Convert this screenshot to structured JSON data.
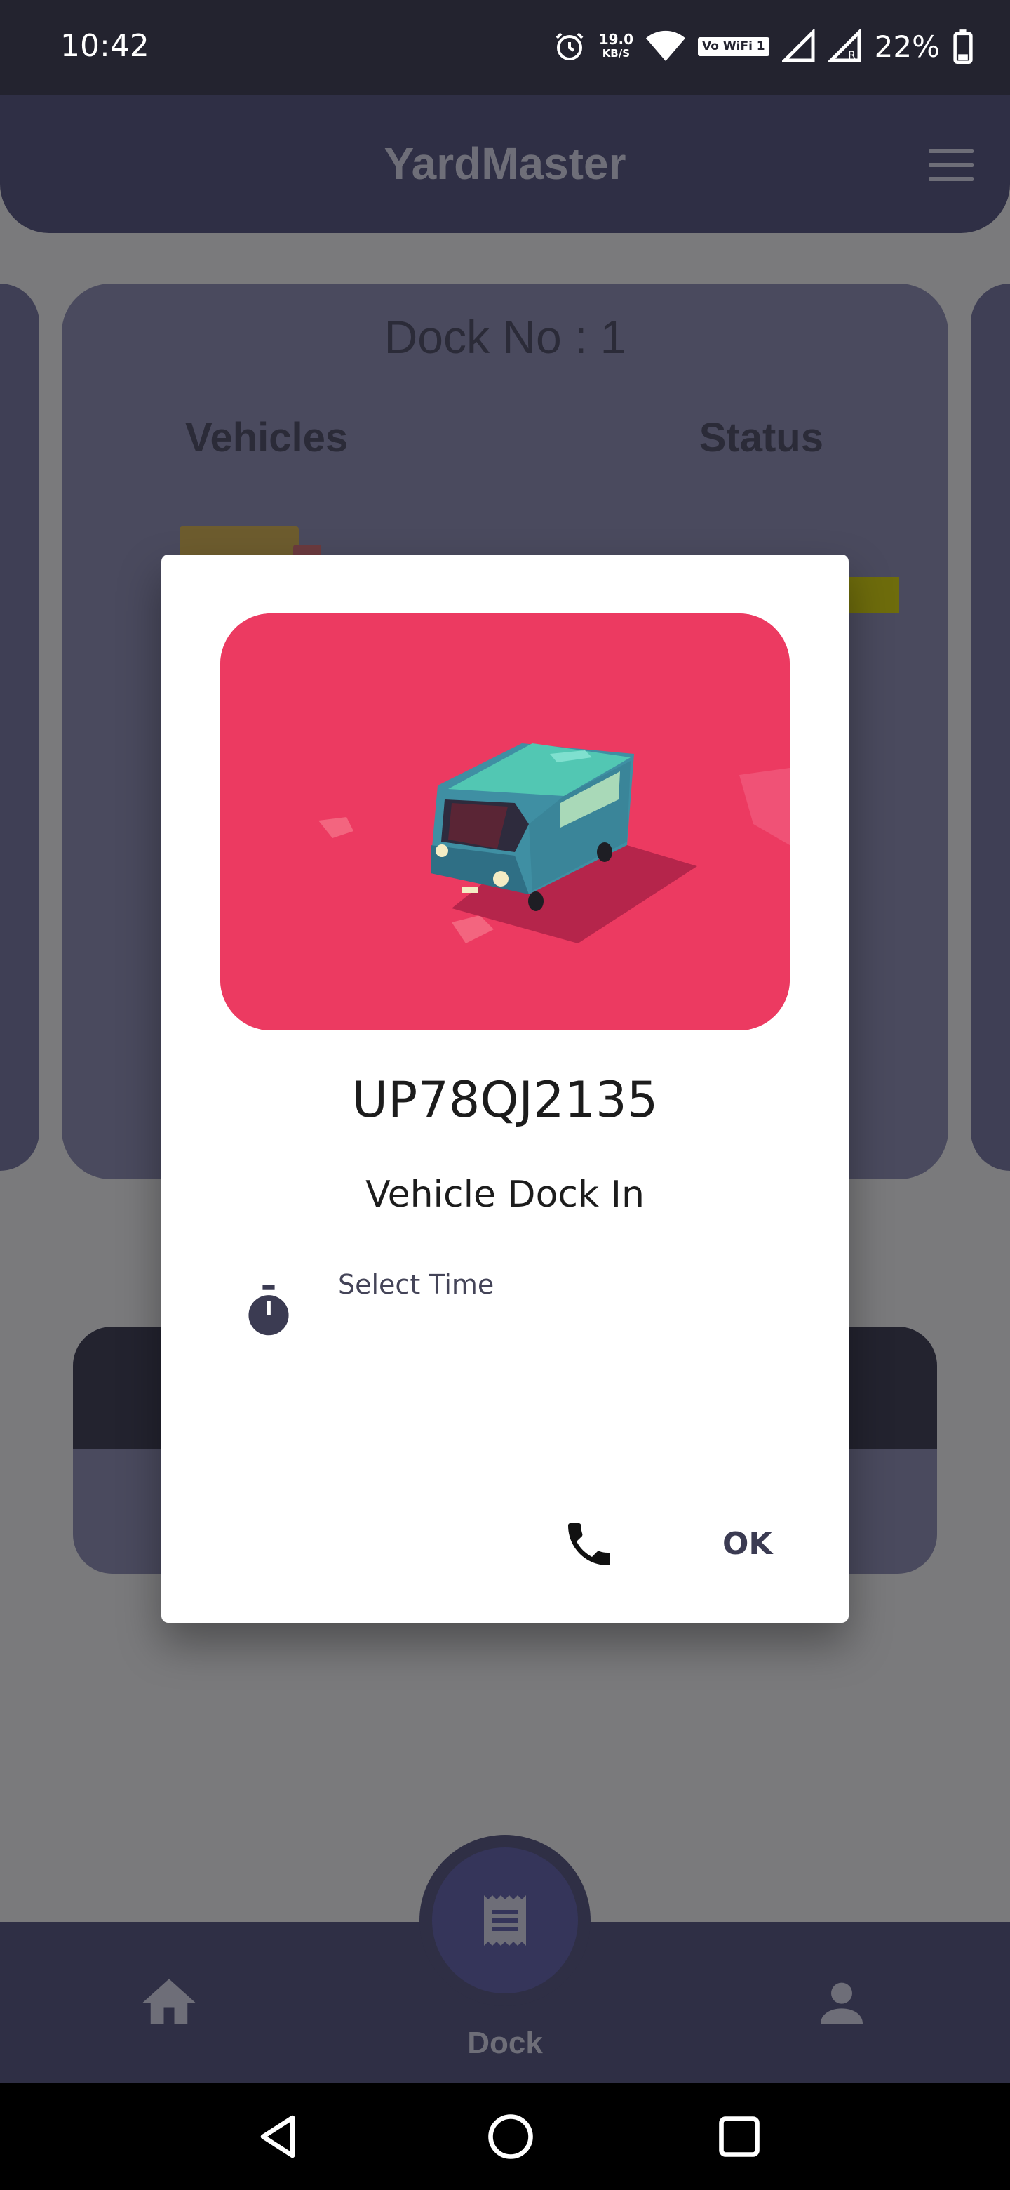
{
  "status_bar": {
    "time": "10:42",
    "net_speed_value": "19.0",
    "net_speed_unit": "KB/S",
    "vowifi": "Vo WiFi 1",
    "battery": "22%"
  },
  "app": {
    "title": "YardMaster"
  },
  "dock_card": {
    "title": "Dock No : 1",
    "col_vehicles": "Vehicles",
    "col_status": "Status"
  },
  "dialog": {
    "vehicle_number": "UP78QJ2135",
    "action": "Vehicle Dock In",
    "select_time_label": "Select Time",
    "ok_label": "OK"
  },
  "bottom_nav": {
    "dock_label": "Dock"
  },
  "colors": {
    "illustration_bg": "#ec3a61",
    "app_dark": "#2f2f45",
    "van_body": "#3f8fa3",
    "van_roof": "#52c7b3"
  }
}
